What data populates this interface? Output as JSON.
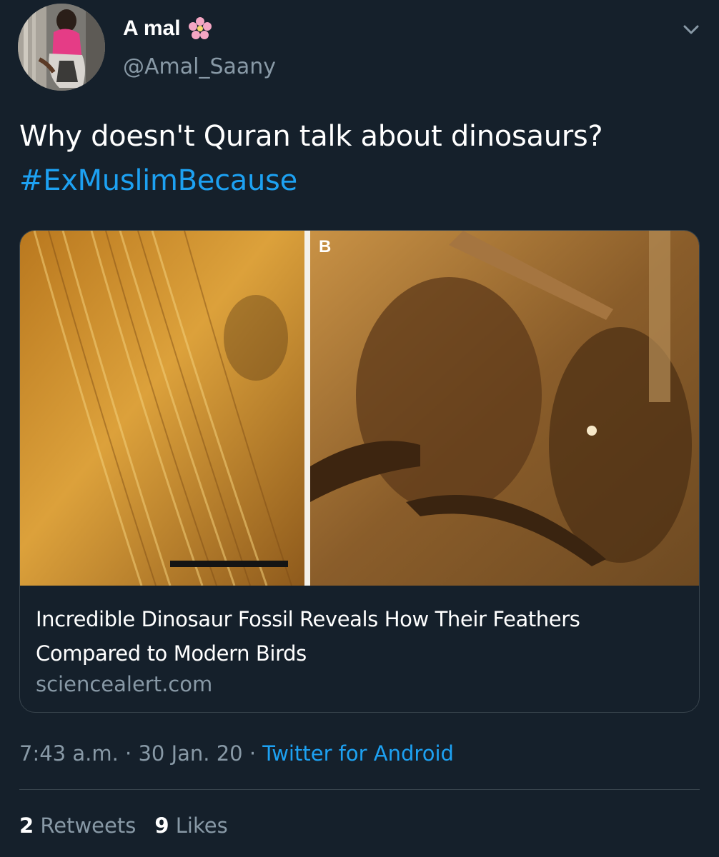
{
  "tweet": {
    "display_name": "A mal",
    "name_emoji": "flower-icon",
    "handle": "@Amal_Saany",
    "text_line1": "Why doesn't Quran talk about dinosaurs?",
    "hashtag": "#ExMuslimBecause",
    "card": {
      "title_line1": "Incredible Dinosaur Fossil Reveals How Their Feathers",
      "title_line2": "Compared to Modern Birds",
      "domain": "sciencealert.com",
      "image_panel_label": "B"
    },
    "time": "7:43 a.m.",
    "sep1": " · ",
    "date": "30 Jan. 20",
    "sep2": " · ",
    "source": "Twitter for Android",
    "stats": {
      "retweets_count": "2",
      "retweets_label": "Retweets",
      "likes_count": "9",
      "likes_label": "Likes"
    }
  },
  "colors": {
    "background": "#15202b",
    "text_primary": "#ffffff",
    "text_secondary": "#8899a6",
    "accent": "#1da1f2",
    "border": "#38444d"
  }
}
